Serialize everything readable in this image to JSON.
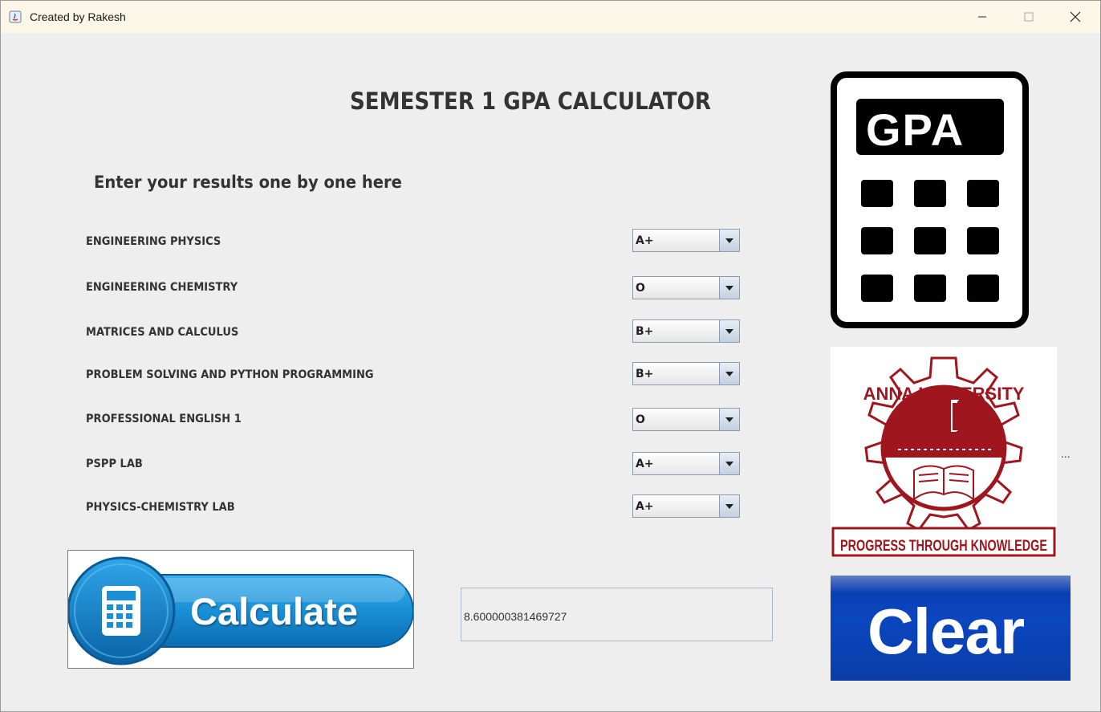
{
  "window": {
    "title": "Created by Rakesh",
    "minimize_icon": "minimize-icon",
    "maximize_icon": "maximize-icon",
    "close_icon": "close-icon"
  },
  "main": {
    "heading": "SEMESTER 1 GPA CALCULATOR",
    "subheading": "Enter your results one by one here",
    "subjects": [
      {
        "name": "ENGINEERING PHYSICS",
        "grade": "A+"
      },
      {
        "name": "ENGINEERING CHEMISTRY",
        "grade": "O"
      },
      {
        "name": "MATRICES AND CALCULUS",
        "grade": "B+"
      },
      {
        "name": "PROBLEM SOLVING AND PYTHON PROGRAMMING",
        "grade": "B+"
      },
      {
        "name": "PROFESSIONAL ENGLISH 1",
        "grade": "O"
      },
      {
        "name": "PSPP LAB",
        "grade": "A+"
      },
      {
        "name": "PHYSICS-CHEMISTRY LAB",
        "grade": "A+"
      }
    ],
    "calculate_label": "Calculate",
    "result_value": "8.600000381469727",
    "gpa_image_text": "GPA",
    "university_name": "ANNA UNIVERSITY",
    "university_motto": "PROGRESS THROUGH KNOWLEDGE",
    "ellipsis": "...",
    "clear_label": "Clear"
  },
  "colors": {
    "window_bg": "#eeeeee",
    "titlebar_bg": "#fbf6e6",
    "calculate_blue": "#1a8fd6",
    "clear_blue": "#0b46c0",
    "anna_red": "#a0161e"
  }
}
